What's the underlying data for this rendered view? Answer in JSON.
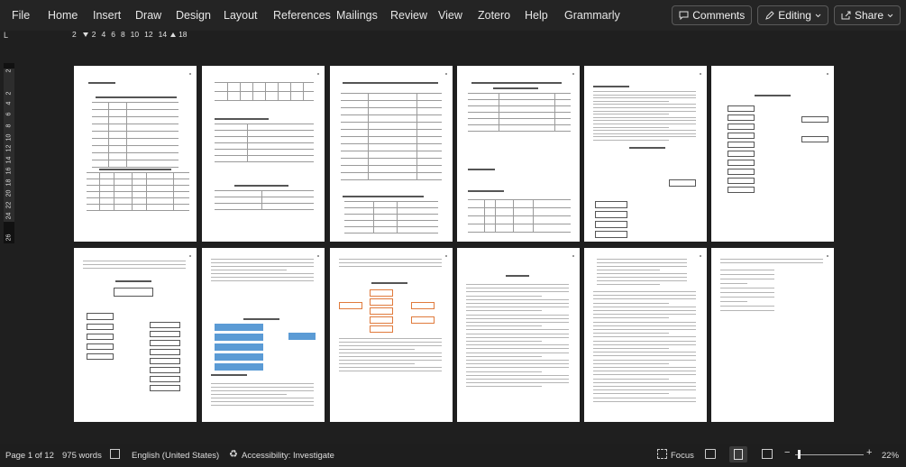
{
  "ribbon": {
    "tabs": [
      "File",
      "Home",
      "Insert",
      "Draw",
      "Design",
      "Layout",
      "References",
      "Mailings",
      "Review",
      "View",
      "Zotero",
      "Help",
      "Grammarly"
    ],
    "comments_label": "Comments",
    "editing_label": "Editing",
    "share_label": "Share"
  },
  "ruler": {
    "left_marker": "2",
    "ticks": [
      "2",
      "4",
      "6",
      "8",
      "10",
      "12",
      "14"
    ],
    "right_marker": "18",
    "tab_selector": "L"
  },
  "vruler": {
    "numbers": [
      "2",
      "2",
      "4",
      "6",
      "8",
      "10",
      "12",
      "14",
      "16",
      "18",
      "20",
      "22",
      "24",
      "26"
    ]
  },
  "status": {
    "page": "Page 1 of 12",
    "words": "975 words",
    "language": "English (United States)",
    "accessibility": "Accessibility: Investigate",
    "focus": "Focus",
    "zoom": "22%"
  }
}
